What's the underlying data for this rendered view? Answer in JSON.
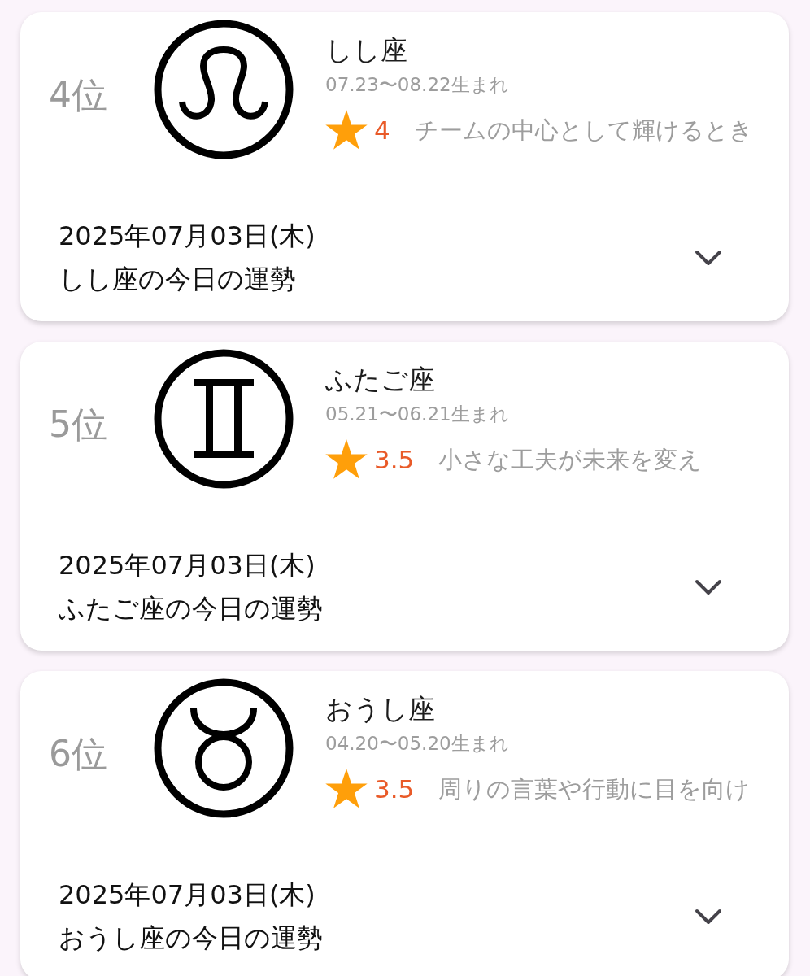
{
  "cards": [
    {
      "rank": "4位",
      "kind": "leo",
      "name": "しし座",
      "period": "07.23〜08.22生まれ",
      "score": "4",
      "summary": "チームの中心として輝けるとき",
      "date": "2025年07月03日(木)",
      "title": "しし座の今日の運勢",
      "expanded": false
    },
    {
      "rank": "5位",
      "kind": "gemini",
      "name": "ふたご座",
      "period": "05.21〜06.21生まれ",
      "score": "3.5",
      "summary": "小さな工夫が未来を変え",
      "date": "2025年07月03日(木)",
      "title": "ふたご座の今日の運勢",
      "expanded": false
    },
    {
      "rank": "6位",
      "kind": "taurus",
      "name": "おうし座",
      "period": "04.20〜05.20生まれ",
      "score": "3.5",
      "summary": "周りの言葉や行動に目を向け",
      "date": "2025年07月03日(木)",
      "title": "おうし座の今日の運勢",
      "expanded": false
    }
  ]
}
